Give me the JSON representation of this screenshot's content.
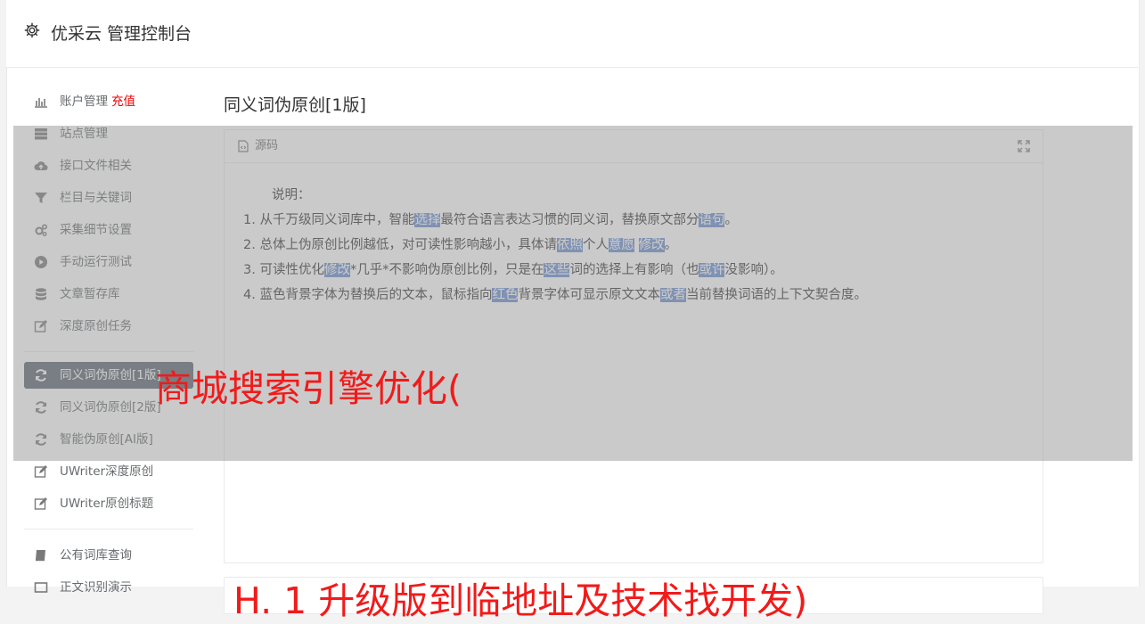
{
  "header": {
    "title": "优采云 管理控制台"
  },
  "sidebar": {
    "group1": [
      {
        "label": "账户管理",
        "badge": "充值"
      },
      {
        "label": "站点管理"
      },
      {
        "label": "接口文件相关"
      },
      {
        "label": "栏目与关键词"
      },
      {
        "label": "采集细节设置"
      },
      {
        "label": "手动运行测试"
      },
      {
        "label": "文章暂存库"
      },
      {
        "label": "深度原创任务"
      }
    ],
    "group2": [
      {
        "label": "同义词伪原创[1版]"
      },
      {
        "label": "同义词伪原创[2版]"
      },
      {
        "label": "智能伪原创[AI版]"
      },
      {
        "label": "UWriter深度原创"
      },
      {
        "label": "UWriter原创标题"
      }
    ],
    "group3": [
      {
        "label": "公有词库查询"
      },
      {
        "label": "正文识别演示"
      }
    ]
  },
  "main": {
    "page_title": "同义词伪原创[1版]",
    "panel_title": "源码",
    "caption": "说明：",
    "lines": [
      {
        "n": "1. ",
        "a": "从千万级同义词库中，智能",
        "h1": "选择",
        "b": "最符合语言表达习惯的同义词，替换原文部分",
        "h2": "语句",
        "c": "。"
      },
      {
        "n": "2. ",
        "a": "总体上伪原创比例越低，对可读性影响越小，具体请",
        "h1": "依照",
        "b": "个人",
        "h2": "意愿",
        "c": "",
        "h3": "修改",
        "d": "。"
      },
      {
        "n": "3. ",
        "a": "可读性优化",
        "h1": "修改",
        "b": "*几乎*不影响伪原创比例，只是在",
        "h2": "这些",
        "c": "词的选择上有影响（也",
        "h3": "或许",
        "d": "没影响）。"
      },
      {
        "n": "4. ",
        "a": "蓝色背景字体为替换后的文本，鼠标指向",
        "h1": "红色",
        "b": "背景字体可显示原文文本",
        "h2": "或者",
        "c": "当前替换词语的上下文契合度。"
      }
    ]
  },
  "watermark": {
    "text1": "商城搜索引擎优化(",
    "text2": "H. 1 升级版到临地址及技术找开发)"
  },
  "colors": {
    "highlight": "#6a8fd0",
    "active_nav": "#5b6770",
    "recharge": "#ed0000",
    "watermark": "#f21a1a"
  }
}
